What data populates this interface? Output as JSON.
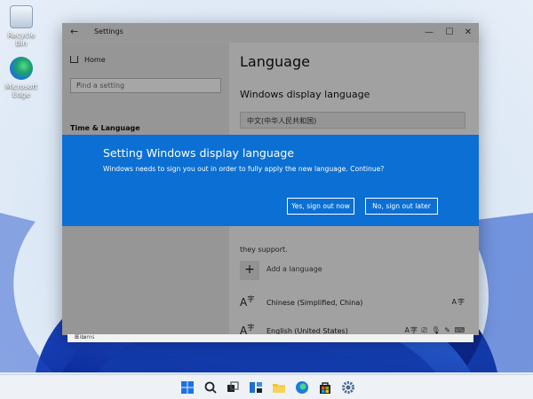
{
  "desktop": {
    "icons": [
      {
        "label": "Recycle Bin"
      },
      {
        "label": "Microsoft Edge"
      }
    ]
  },
  "window": {
    "title": "Settings",
    "back_glyph": "←",
    "controls": {
      "minimize": "—",
      "maximize": "☐",
      "close": "✕"
    },
    "sidebar": {
      "home_label": "Home",
      "search_placeholder": "Find a setting",
      "section_title": "Time & Language"
    },
    "main": {
      "heading": "Language",
      "subheading": "Windows display language",
      "display_language_value": "中文(中华人民共和国)",
      "support_text": "they support.",
      "add_language_label": "Add a language",
      "languages": [
        {
          "name": "Chinese (Simplified, China)",
          "features": "A字"
        },
        {
          "name": "English (United States)",
          "features": "A字 ⎚ 🎙 ✎ ⌨"
        }
      ]
    }
  },
  "explorer_status": {
    "items_text": "8 items"
  },
  "dialog": {
    "title": "Setting Windows display language",
    "message": "Windows needs to sign you out in order to fully apply the new language. Continue?",
    "yes_label": "Yes, sign out now",
    "no_label": "No, sign out later",
    "accent": "#0b6fd3"
  },
  "taskbar": {
    "icons": [
      "start-icon",
      "search-icon",
      "task-view-icon",
      "widgets-icon",
      "file-explorer-icon",
      "edge-icon",
      "store-icon",
      "settings-icon"
    ]
  }
}
